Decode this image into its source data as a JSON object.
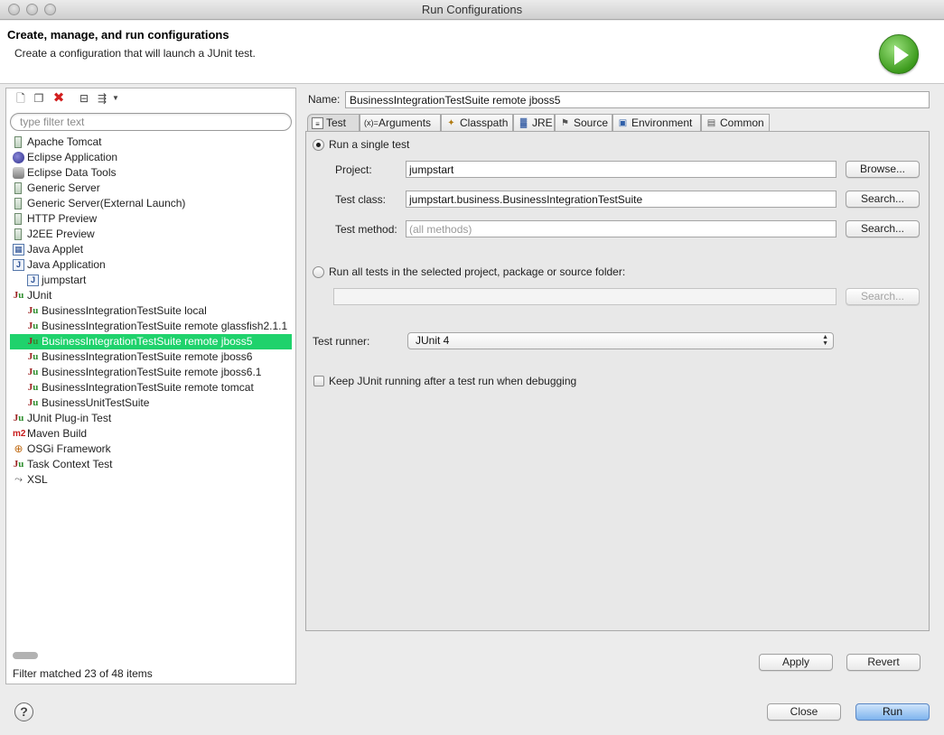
{
  "window": {
    "title": "Run Configurations"
  },
  "header": {
    "title": "Create, manage, and run configurations",
    "subtitle": "Create a configuration that will launch a JUnit test."
  },
  "sidebar": {
    "filter_placeholder": "type filter text",
    "items": [
      {
        "label": "Apache Tomcat",
        "icon": "server-icon",
        "level": 0
      },
      {
        "label": "Eclipse Application",
        "icon": "eclipse-icon",
        "level": 0
      },
      {
        "label": "Eclipse Data Tools",
        "icon": "database-icon",
        "level": 0
      },
      {
        "label": "Generic Server",
        "icon": "server-icon",
        "level": 0
      },
      {
        "label": "Generic Server(External Launch)",
        "icon": "server-icon",
        "level": 0
      },
      {
        "label": "HTTP Preview",
        "icon": "server-icon",
        "level": 0
      },
      {
        "label": "J2EE Preview",
        "icon": "server-icon",
        "level": 0
      },
      {
        "label": "Java Applet",
        "icon": "java-applet-icon",
        "level": 0
      },
      {
        "label": "Java Application",
        "icon": "java-app-icon",
        "level": 0
      },
      {
        "label": "jumpstart",
        "icon": "java-app-icon",
        "level": 1
      },
      {
        "label": "JUnit",
        "icon": "junit-icon",
        "level": 0
      },
      {
        "label": "BusinessIntegrationTestSuite local",
        "icon": "junit-icon",
        "level": 1
      },
      {
        "label": "BusinessIntegrationTestSuite remote glassfish2.1.1",
        "icon": "junit-icon",
        "level": 1
      },
      {
        "label": "BusinessIntegrationTestSuite remote jboss5",
        "icon": "junit-icon",
        "level": 1,
        "selected": true
      },
      {
        "label": "BusinessIntegrationTestSuite remote jboss6",
        "icon": "junit-icon",
        "level": 1
      },
      {
        "label": "BusinessIntegrationTestSuite remote jboss6.1",
        "icon": "junit-icon",
        "level": 1
      },
      {
        "label": "BusinessIntegrationTestSuite remote tomcat",
        "icon": "junit-icon",
        "level": 1
      },
      {
        "label": "BusinessUnitTestSuite",
        "icon": "junit-icon",
        "level": 1
      },
      {
        "label": "JUnit Plug-in Test",
        "icon": "junit-plugin-icon",
        "level": 0
      },
      {
        "label": "Maven Build",
        "icon": "maven-icon",
        "level": 0
      },
      {
        "label": "OSGi Framework",
        "icon": "osgi-icon",
        "level": 0
      },
      {
        "label": "Task Context Test",
        "icon": "junit-task-icon",
        "level": 0
      },
      {
        "label": "XSL",
        "icon": "xsl-icon",
        "level": 0
      }
    ],
    "status": "Filter matched 23 of 48 items"
  },
  "config": {
    "name_label": "Name:",
    "name_value": "BusinessIntegrationTestSuite remote jboss5",
    "tabs": [
      {
        "label": "Test",
        "icon": "test-tab-icon",
        "active": true
      },
      {
        "label": "Arguments",
        "icon": "arguments-icon"
      },
      {
        "label": "Classpath",
        "icon": "classpath-icon"
      },
      {
        "label": "JRE",
        "icon": "jre-icon"
      },
      {
        "label": "Source",
        "icon": "source-icon"
      },
      {
        "label": "Environment",
        "icon": "environment-icon"
      },
      {
        "label": "Common",
        "icon": "common-icon"
      }
    ],
    "single_test_label": "Run a single test",
    "project_label": "Project:",
    "project_value": "jumpstart",
    "browse_label": "Browse...",
    "test_class_label": "Test class:",
    "test_class_value": "jumpstart.business.BusinessIntegrationTestSuite",
    "search_label": "Search...",
    "test_method_label": "Test method:",
    "test_method_placeholder": "(all methods)",
    "all_tests_label": "Run all tests in the selected project, package or source folder:",
    "runner_label": "Test runner:",
    "runner_value": "JUnit 4",
    "keep_running_label": "Keep JUnit running after a test run when debugging",
    "apply_label": "Apply",
    "revert_label": "Revert"
  },
  "footer": {
    "help_label": "?",
    "close_label": "Close",
    "run_label": "Run"
  },
  "colors": {
    "selection": "#1fd26c",
    "run_button": "#7fb4ee"
  }
}
